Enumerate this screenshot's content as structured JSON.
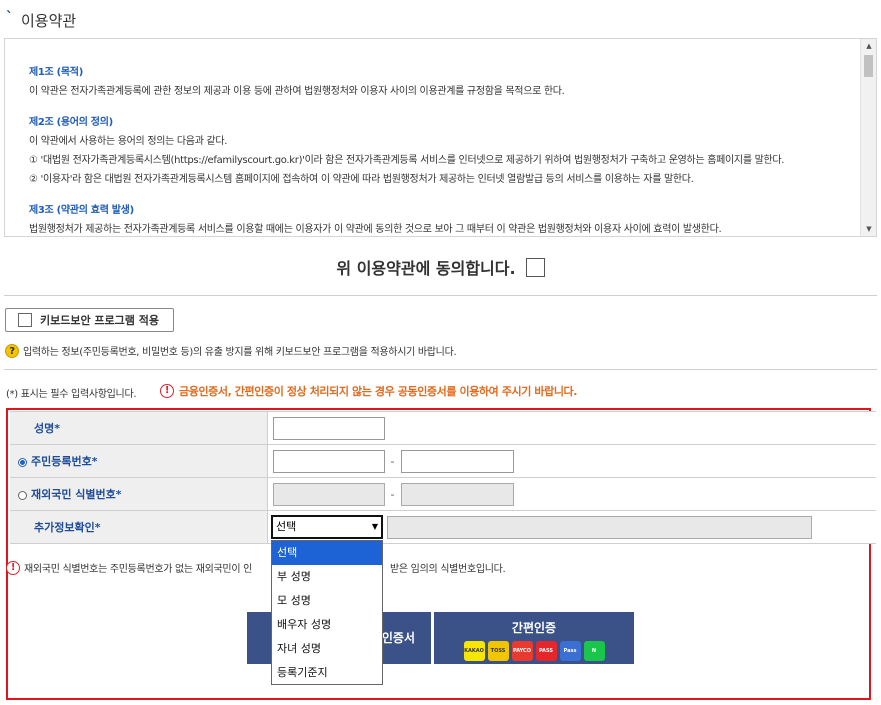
{
  "section_title": "이용약관",
  "terms": {
    "articles": [
      {
        "heading": "제1조 (목적)",
        "lines": [
          "이 약관은 전자가족관계등록에 관한 정보의 제공과 이용 등에 관하여 법원행정처와 이용자 사이의 이용관계를 규정함을 목적으로 한다."
        ]
      },
      {
        "heading": "제2조 (용어의 정의)",
        "lines": [
          "이 약관에서 사용하는 용어의 정의는 다음과 같다.",
          "① '대법원 전자가족관계등록시스템(https://efamilyscourt.go.kr)'이라 함은 전자가족관계등록 서비스를 인터넷으로 제공하기 위하여 법원행정처가 구축하고 운영하는 홈페이지를 말한다.",
          "② '이용자'라 함은 대법원 전자가족관계등록시스템 홈페이지에 접속하여 이 약관에 따라 법원행정처가 제공하는 인터넷 열람발급 등의 서비스를 이용하는 자를 말한다."
        ]
      },
      {
        "heading": "제3조 (약관의 효력 발생)",
        "lines": [
          "법원행정처가 제공하는 전자가족관계등록 서비스를 이용할 때에는 이용자가 이 약관에 동의한 것으로 보아 그 때부터 이 약관은 법원행정처와 이용자 사이에 효력이 발생한다."
        ]
      }
    ]
  },
  "agree_label": "위 이용약관에 동의합니다.",
  "keyboard_security_label": "키보드보안 프로그램 적용",
  "keyboard_notice": "입력하는 정보(주민등록번호, 비밀번호 등)의 유출 방지를 위해 키보드보안 프로그램을 적용하시기 바랍니다.",
  "required_note": "(*) 표시는 필수 입력사항입니다.",
  "cert_warning": "금융인증서, 간편인증이 정상 처리되지 않는 경우 공동인증서를 이용하여 주시기 바랍니다.",
  "form": {
    "name_label": "성명",
    "rrn_label": "주민등록번호",
    "foreign_label": "재외국민 식별번호",
    "extra_label": "추가정보확인",
    "required_mark": "*",
    "dash": "-"
  },
  "select": {
    "current": "선택",
    "options": [
      "선택",
      "부 성명",
      "모 성명",
      "배우자 성명",
      "자녀 성명",
      "등록기준지"
    ]
  },
  "foreign_notice_left": "재외국민 식별번호는 주민등록번호가 없는 재외국민이 인",
  "foreign_notice_right": "받은 임의의 식별번호입니다.",
  "buttons": {
    "cert_partial": "인증서",
    "easy_auth": "간편인증"
  },
  "easy_logos": [
    {
      "text": "KAKAO",
      "color": "#f7e600"
    },
    {
      "text": "TOSS",
      "color": "#f1c600"
    },
    {
      "text": "PAYCO",
      "color": "#e83a2f"
    },
    {
      "text": "PASS",
      "color": "#e5262b"
    },
    {
      "text": "Pass",
      "color": "#3b6fd1"
    },
    {
      "text": "N",
      "color": "#19c54a"
    }
  ]
}
